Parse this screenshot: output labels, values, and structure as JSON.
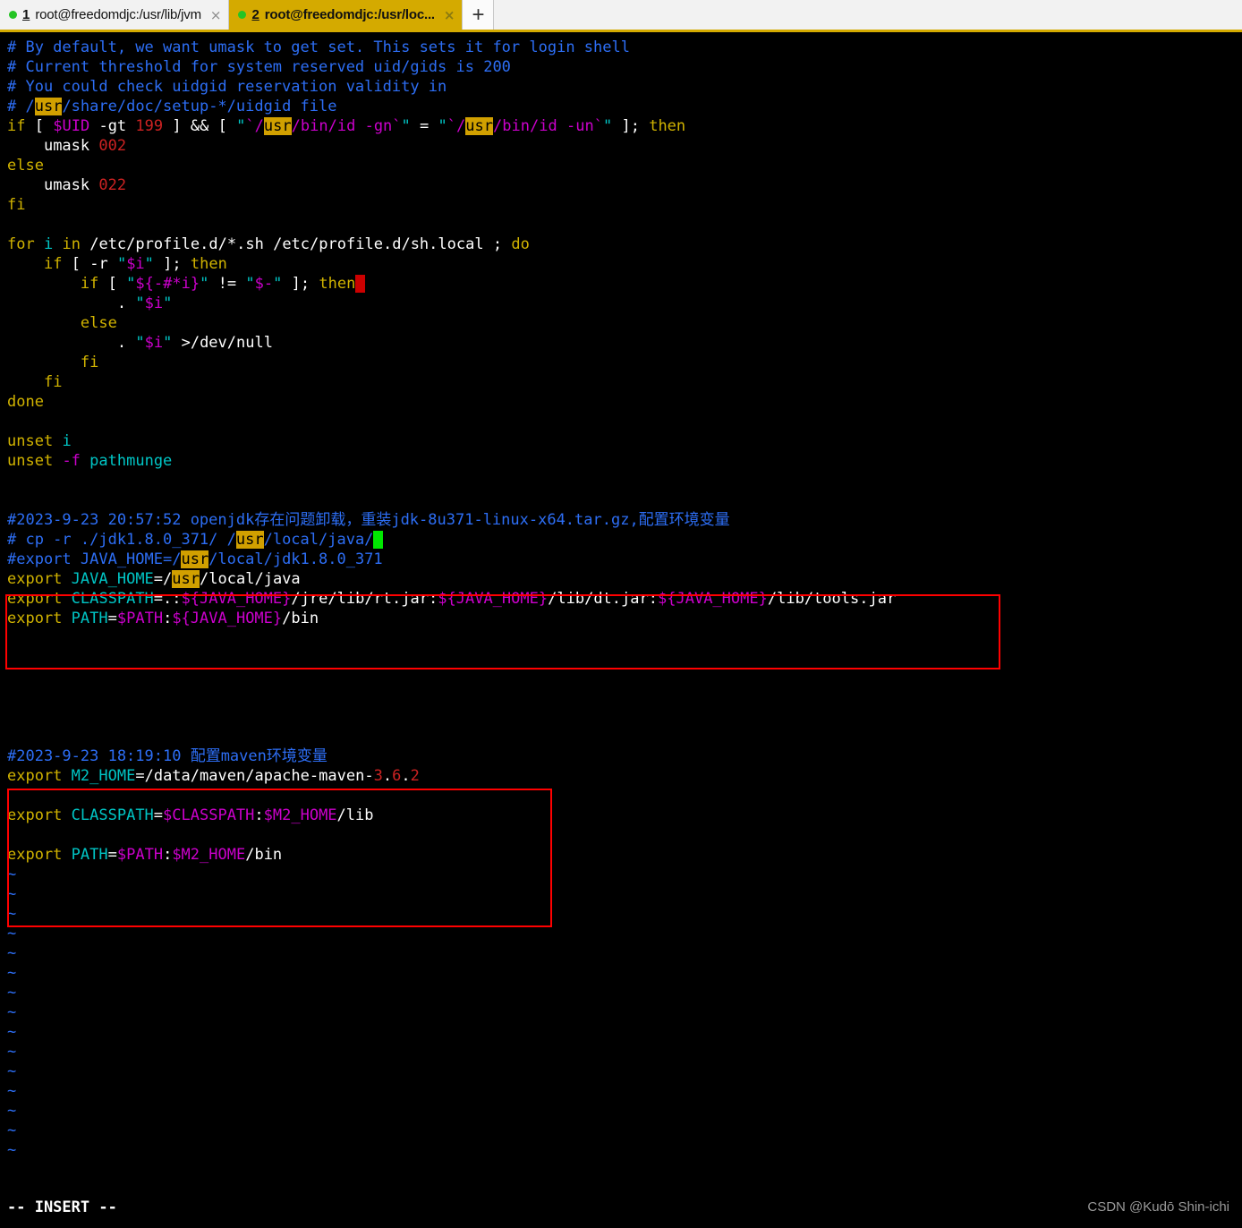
{
  "window": {
    "tabs": [
      {
        "index_label": "1",
        "title": "root@freedomdjc:/usr/lib/jvm",
        "close": "×",
        "status_dot": "green-dot",
        "active": false
      },
      {
        "index_label": "2",
        "title": "root@freedomdjc:/usr/loc...",
        "close": "×",
        "status_dot": "green-dot",
        "active": true
      }
    ],
    "new_tab_label": "+",
    "active_tab_color": "#d4aa00"
  },
  "editor": {
    "mode_status": "-- INSERT --",
    "watermark": "CSDN @Kudō Shin-ichi",
    "tilde_glyph": "~",
    "tilde_count": 15,
    "lines": [
      "# By default, we want umask to get set. This sets it for login shell",
      "# Current threshold for system reserved uid/gids is 200",
      "# You could check uidgid reservation validity in",
      "# /usr/share/doc/setup-*/uidgid file",
      "if [ $UID -gt 199 ] && [ \"`/usr/bin/id -gn`\" = \"`/usr/bin/id -un`\" ]; then",
      "    umask 002",
      "else",
      "    umask 022",
      "fi",
      "",
      "for i in /etc/profile.d/*.sh /etc/profile.d/sh.local ; do",
      "    if [ -r \"$i\" ]; then",
      "        if [ \"${-#*i}\" != \"$-\" ]; then",
      "            . \"$i\"",
      "        else",
      "            . \"$i\" >/dev/null",
      "        fi",
      "    fi",
      "done",
      "",
      "unset i",
      "unset -f pathmunge",
      "",
      "",
      "#2023-9-23 20:57:52 openjdk存在问题卸载，重装jdk-8u371-linux-x64.tar.gz,配置环境变量",
      "# cp -r ./jdk1.8.0_371/ /usr/local/java/",
      "#export JAVA_HOME=/usr/local/jdk1.8.0_371",
      "export JAVA_HOME=/usr/local/java",
      "export CLASSPATH=.:${JAVA_HOME}/jre/lib/rt.jar:${JAVA_HOME}/lib/dt.jar:${JAVA_HOME}/lib/tools.jar",
      "export PATH=$PATH:${JAVA_HOME}/bin",
      "",
      "",
      "",
      "",
      "",
      "",
      "#2023-9-23 18:19:10 配置maven环境变量",
      "export M2_HOME=/data/maven/apache-maven-3.6.2",
      "",
      "export CLASSPATH=$CLASSPATH:$M2_HOME/lib",
      "",
      "export PATH=$PATH:$M2_HOME/bin"
    ],
    "search_term": "usr",
    "cursors": [
      {
        "line": 12,
        "color": "#cc0000",
        "after": "then"
      },
      {
        "line": 25,
        "color": "#00e800",
        "after": "/usr/local/java/"
      }
    ],
    "annotations": [
      {
        "name": "java-env-box",
        "color": "#ff0000",
        "covers": "export JAVA_HOME / CLASSPATH / PATH"
      },
      {
        "name": "maven-env-box",
        "color": "#ff0000",
        "covers": "maven comment + export M2_HOME / CLASSPATH / PATH"
      }
    ]
  },
  "colors": {
    "comment": "#2d6ef5",
    "keyword": "#d1b300",
    "identifier": "#00c5c5",
    "variable": "#cc00cc",
    "number": "#cc2222",
    "highlight_bg": "#d1a000",
    "plain": "#ffffff",
    "annotation": "#ff0000"
  }
}
